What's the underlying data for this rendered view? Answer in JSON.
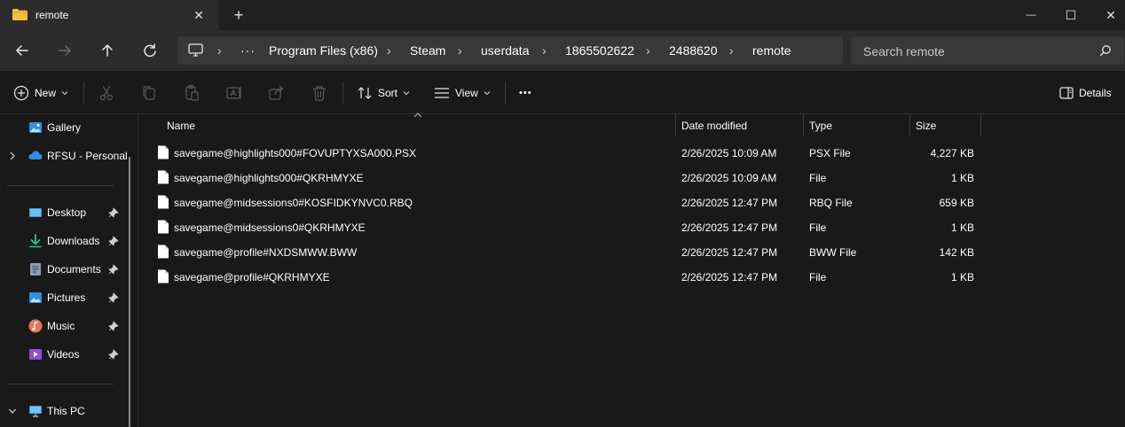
{
  "window": {
    "tab_title": "remote",
    "close_tab_glyph": "✕",
    "new_tab_glyph": "+",
    "minimize_glyph": "—",
    "maximize_glyph": "☐",
    "close_glyph": "✕"
  },
  "address": {
    "more_glyph": "···",
    "separator_glyph": "›",
    "crumbs": [
      "Program Files (x86)",
      "Steam",
      "userdata",
      "1865502622",
      "2488620",
      "remote"
    ]
  },
  "search": {
    "placeholder": "Search remote"
  },
  "toolbar": {
    "new_label": "New",
    "sort_label": "Sort",
    "view_label": "View",
    "more_glyph": "•••",
    "details_label": "Details"
  },
  "sidebar": {
    "gallery": "Gallery",
    "onedrive": "RFSU - Personal",
    "pinned": [
      {
        "label": "Desktop",
        "icon": "desktop-icon"
      },
      {
        "label": "Downloads",
        "icon": "downloads-icon"
      },
      {
        "label": "Documents",
        "icon": "documents-icon"
      },
      {
        "label": "Pictures",
        "icon": "pictures-icon"
      },
      {
        "label": "Music",
        "icon": "music-icon"
      },
      {
        "label": "Videos",
        "icon": "videos-icon"
      }
    ],
    "this_pc": "This PC"
  },
  "columns": {
    "name": "Name",
    "date": "Date modified",
    "type": "Type",
    "size": "Size"
  },
  "files": [
    {
      "name": "savegame@highlights000#FOVUPTYXSA000.PSX",
      "date": "2/26/2025 10:09 AM",
      "type": "PSX File",
      "size": "4,227 KB"
    },
    {
      "name": "savegame@highlights000#QKRHMYXE",
      "date": "2/26/2025 10:09 AM",
      "type": "File",
      "size": "1 KB"
    },
    {
      "name": "savegame@midsessions0#KOSFIDKYNVC0.RBQ",
      "date": "2/26/2025 12:47 PM",
      "type": "RBQ File",
      "size": "659 KB"
    },
    {
      "name": "savegame@midsessions0#QKRHMYXE",
      "date": "2/26/2025 12:47 PM",
      "type": "File",
      "size": "1 KB"
    },
    {
      "name": "savegame@profile#NXDSMWW.BWW",
      "date": "2/26/2025 12:47 PM",
      "type": "BWW File",
      "size": "142 KB"
    },
    {
      "name": "savegame@profile#QKRHMYXE",
      "date": "2/26/2025 12:47 PM",
      "type": "File",
      "size": "1 KB"
    }
  ],
  "colors": {
    "folder": "#f3c13a",
    "accent": "#4cc2ff",
    "window_bg": "#191919",
    "chrome_bg": "#2c2c2c"
  }
}
